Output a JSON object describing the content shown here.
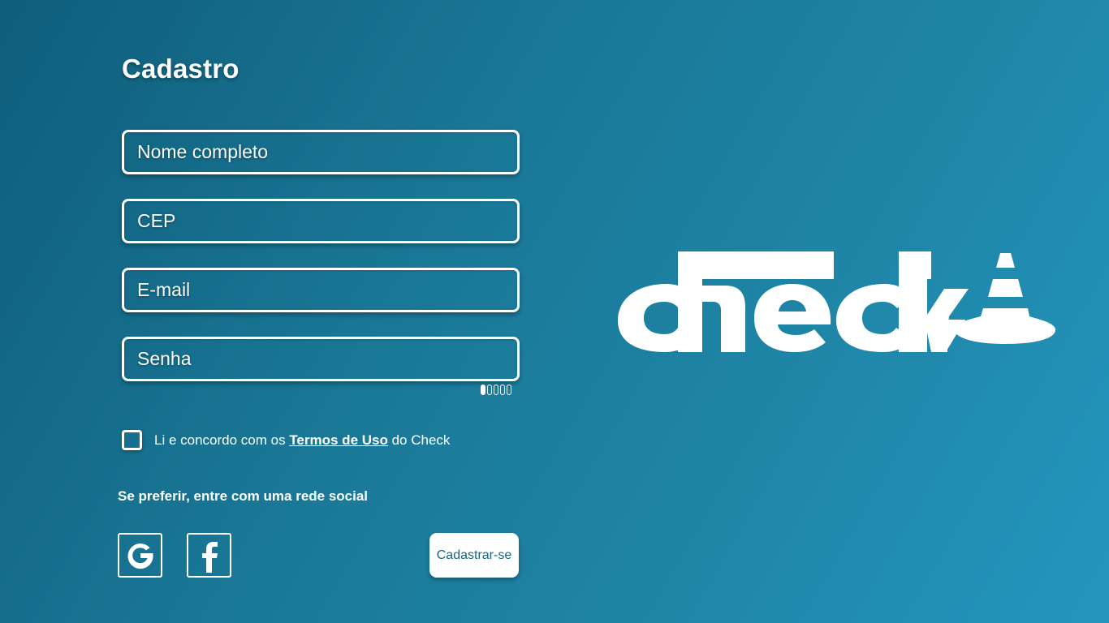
{
  "page": {
    "title": "Cadastro"
  },
  "form": {
    "name_placeholder": "Nome completo",
    "cep_placeholder": "CEP",
    "email_placeholder": "E-mail",
    "password_placeholder": "Senha",
    "password_strength": {
      "level": 1,
      "max": 5
    }
  },
  "terms": {
    "prefix": "Li e concordo com os ",
    "link": "Termos de Uso",
    "suffix": " do Check",
    "checked": false
  },
  "social": {
    "label": "Se preferir, entre com uma rede social",
    "google_icon": "google-icon",
    "facebook_icon": "facebook-icon"
  },
  "actions": {
    "submit_label": "Cadastrar-se"
  },
  "logo": {
    "text": "check",
    "icon": "traffic-cone-icon"
  },
  "colors": {
    "background_start": "#0f5e7c",
    "background_end": "#2496bd",
    "button_text": "#17657f",
    "foreground": "#ffffff"
  }
}
